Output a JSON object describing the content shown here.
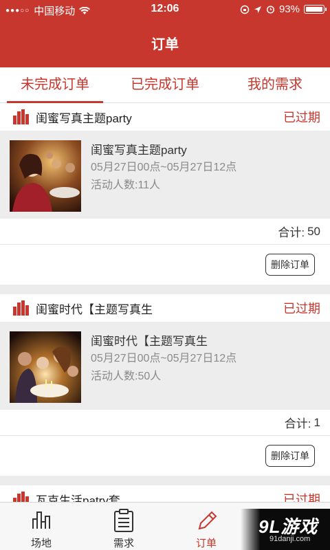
{
  "status_bar": {
    "carrier": "中国移动",
    "time": "12:06",
    "battery": "93%"
  },
  "header": {
    "title": "订单"
  },
  "tabs": [
    {
      "label": "未完成订单",
      "active": true
    },
    {
      "label": "已完成订单",
      "active": false
    },
    {
      "label": "我的需求",
      "active": false
    }
  ],
  "orders": [
    {
      "shop": "闺蜜写真主题party",
      "status": "已过期",
      "title": "闺蜜写真主题party",
      "time": "05月27日00点~05月27日12点",
      "count": "活动人数:11人",
      "total_label": "合计:",
      "total_value": "50",
      "delete_label": "删除订单"
    },
    {
      "shop": "闺蜜时代【主题写真生",
      "status": "已过期",
      "title": "闺蜜时代【主题写真生",
      "time": "05月27日00点~05月27日12点",
      "count": "活动人数:50人",
      "total_label": "合计:",
      "total_value": "1",
      "delete_label": "删除订单"
    },
    {
      "shop": "瓦克生活patry套",
      "status": "已过期"
    }
  ],
  "tabbar": [
    {
      "label": "场地",
      "icon": "venue-icon"
    },
    {
      "label": "需求",
      "icon": "clipboard-icon"
    },
    {
      "label": "订单",
      "icon": "pencil-icon",
      "active": true
    },
    {
      "label": "",
      "icon": "user-icon"
    }
  ],
  "watermark": {
    "main": "9L游戏",
    "sub": "91danji.com"
  },
  "colors": {
    "accent": "#c8372d",
    "background": "#ececec"
  }
}
